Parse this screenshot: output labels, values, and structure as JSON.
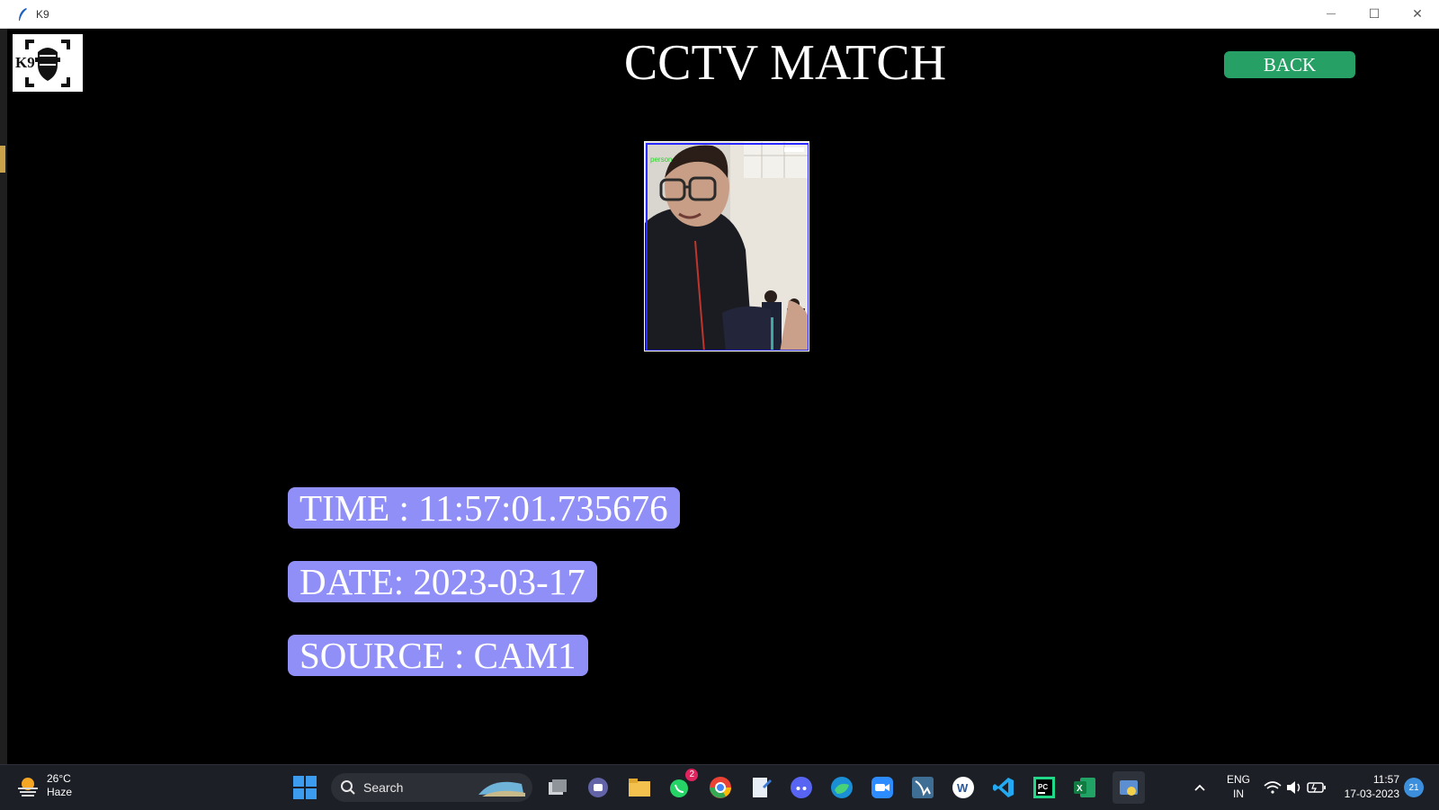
{
  "window": {
    "title": "K9",
    "minimize_glyph": "—",
    "maximize_glyph": "☐",
    "close_glyph": "✕"
  },
  "app": {
    "logo_text": "K9",
    "page_title": "CCTV MATCH",
    "back_label": "BACK",
    "detection_label": "person",
    "time_text": "TIME : 11:57:01.735676",
    "date_text": "DATE: 2023-03-17",
    "source_text": "SOURCE : CAM1",
    "colors": {
      "back_button": "#26a065",
      "info_pill": "#8f8ff7",
      "background": "#000000",
      "frame_border": "#2a2aff",
      "detection_label": "#2bd42b"
    }
  },
  "taskbar": {
    "weather_temp": "26°C",
    "weather_desc": "Haze",
    "search_label": "Search",
    "whatsapp_badge": "2",
    "language_top": "ENG",
    "language_bottom": "IN",
    "time": "11:57",
    "date": "17-03-2023",
    "notification_count": "21",
    "icons": [
      "windows-start-icon",
      "search-icon",
      "task-view-icon",
      "teams-chat-icon",
      "file-explorer-icon",
      "whatsapp-icon",
      "chrome-icon",
      "notepad-icon",
      "discord-icon",
      "edge-icon",
      "zoom-icon",
      "mysql-workbench-icon",
      "word-icon",
      "vscode-icon",
      "pycharm-icon",
      "excel-icon",
      "python-idle-icon",
      "chevron-up-icon",
      "wifi-icon",
      "volume-icon",
      "battery-icon"
    ]
  }
}
